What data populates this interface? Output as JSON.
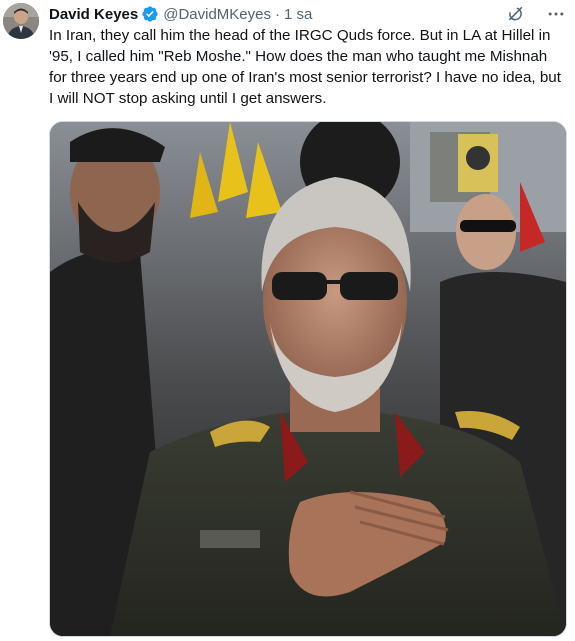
{
  "tweet": {
    "author_name": "David Keyes",
    "handle": "@DavidMKeyes",
    "separator": "·",
    "time": "1 sa",
    "text": "In Iran, they call him the head of the IRGC Quds force. But in LA at Hillel in '95, I called him \"Reb Moshe.\" How does the man who taught me Mishnah for three years end up one of Iran's most senior terrorist? I have no idea, but I will NOT stop asking until I get answers."
  },
  "icons": {
    "verified": "verified-badge-icon",
    "grok": "grok-icon",
    "more": "more-options-icon"
  },
  "colors": {
    "verified_blue": "#1d9bf0",
    "secondary_text": "#536471",
    "primary_text": "#0f1419",
    "flag_yellow": "#e8c21a"
  }
}
